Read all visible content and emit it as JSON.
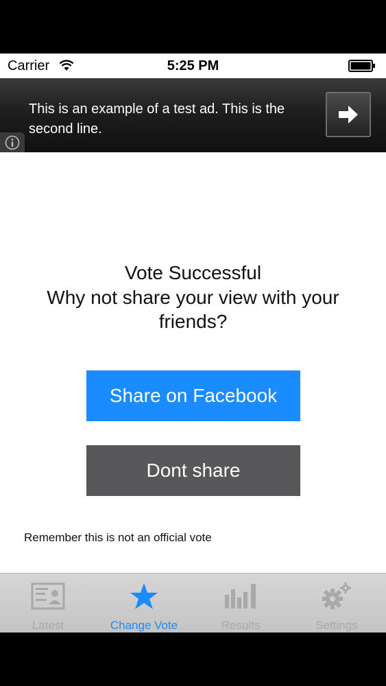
{
  "status_bar": {
    "carrier": "Carrier",
    "time": "5:25 PM"
  },
  "ad": {
    "text": "This is an example of a test ad. This is the second line.",
    "arrow_icon": "arrow-right-icon",
    "info_icon": "info-icon"
  },
  "main": {
    "title": "Vote Successful",
    "subtitle": "Why not share your view with your friends?",
    "share_button": "Share on Facebook",
    "dont_share_button": "Dont share",
    "disclaimer": "Remember this is not an official vote"
  },
  "tab_bar": {
    "tabs": [
      {
        "label": "Latest",
        "icon": "id-card-icon",
        "active": false
      },
      {
        "label": "Change Vote",
        "icon": "star-icon",
        "active": true
      },
      {
        "label": "Results",
        "icon": "bar-chart-icon",
        "active": false
      },
      {
        "label": "Settings",
        "icon": "gears-icon",
        "active": false
      }
    ]
  },
  "colors": {
    "accent": "#1a8cff",
    "secondary_button": "#58575a",
    "inactive_tab": "#a9a9a9"
  }
}
